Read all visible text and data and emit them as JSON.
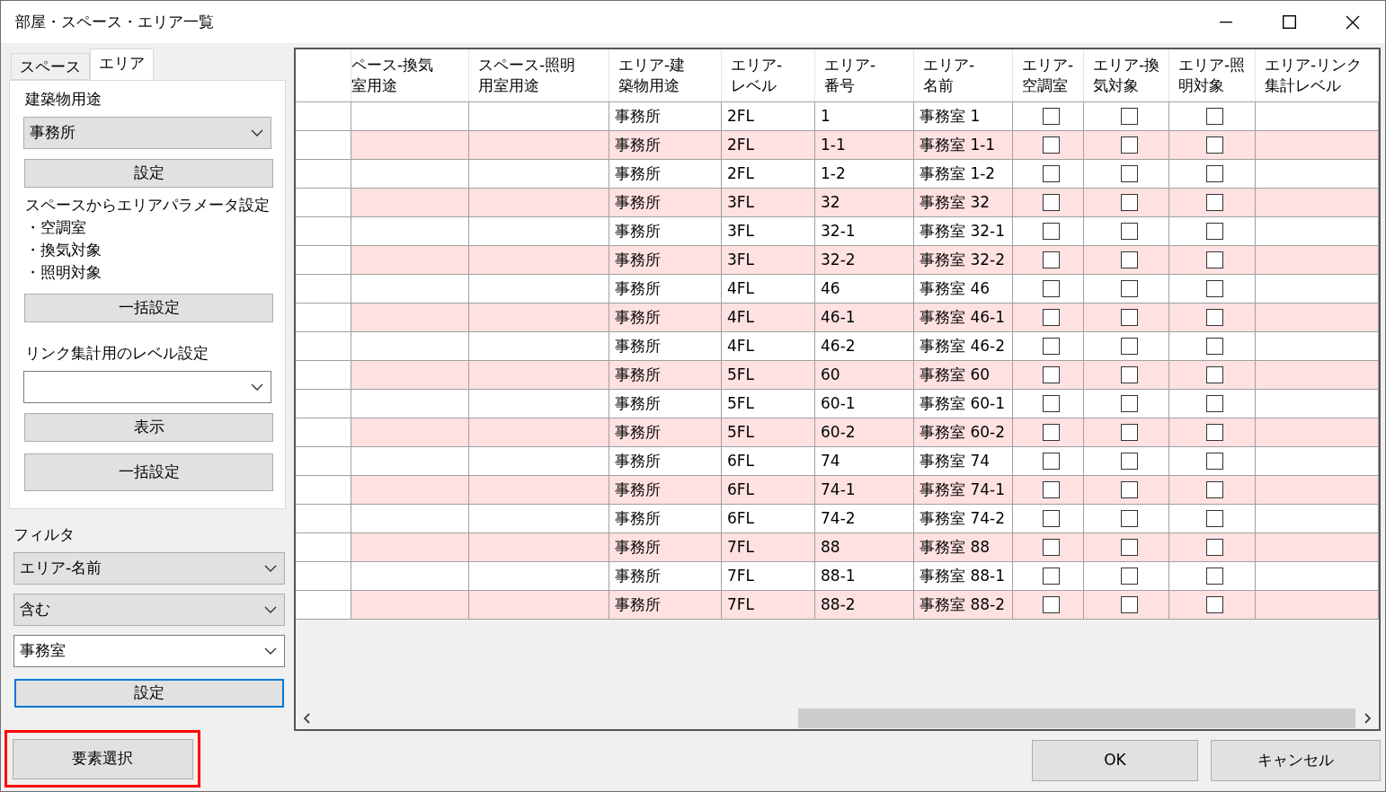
{
  "window": {
    "title": "部屋・スペース・エリア一覧"
  },
  "tabs": [
    {
      "label": "スペース",
      "selected": false
    },
    {
      "label": "エリア",
      "selected": true
    }
  ],
  "area_panel": {
    "building_use_label": "建築物用途",
    "building_use_select": "事務所",
    "set_button": "設定",
    "param_lines": [
      "スペースからエリアパラメータ設定",
      "・空調室",
      "・換気対象",
      "・照明対象"
    ],
    "bulk_button": "一括設定",
    "link_level_label": "リンク集計用のレベル設定",
    "show_button": "表示",
    "bulk_button_2": "一括設定"
  },
  "filter": {
    "label": "フィルタ",
    "field_select": "エリア-名前",
    "condition_select": "含む",
    "value_combo": "事務室",
    "set_button": "設定"
  },
  "table": {
    "columns": [
      {
        "lines": [
          "ペース-換気",
          "室用途"
        ]
      },
      {
        "lines": [
          "スペース-照明",
          "用室用途"
        ]
      },
      {
        "lines": [
          "エリア-建",
          "築物用途"
        ]
      },
      {
        "lines": [
          "エリア-",
          "レベル"
        ]
      },
      {
        "lines": [
          "エリア-",
          "番号"
        ]
      },
      {
        "lines": [
          "エリア-",
          "名前"
        ]
      },
      {
        "lines": [
          "エリア-",
          "空調室"
        ]
      },
      {
        "lines": [
          "エリア-換",
          "気対象"
        ]
      },
      {
        "lines": [
          "エリア-照",
          "明対象"
        ]
      },
      {
        "lines": [
          "エリア-リンク",
          "集計レベル"
        ]
      }
    ],
    "rows": [
      {
        "building_use": "事務所",
        "level": "2FL",
        "number": "1",
        "name": "事務室 1",
        "air_conditioned": false,
        "ventilated": false,
        "lit": false
      },
      {
        "building_use": "事務所",
        "level": "2FL",
        "number": "1-1",
        "name": "事務室 1-1",
        "air_conditioned": false,
        "ventilated": false,
        "lit": false
      },
      {
        "building_use": "事務所",
        "level": "2FL",
        "number": "1-2",
        "name": "事務室 1-2",
        "air_conditioned": false,
        "ventilated": false,
        "lit": false
      },
      {
        "building_use": "事務所",
        "level": "3FL",
        "number": "32",
        "name": "事務室 32",
        "air_conditioned": false,
        "ventilated": false,
        "lit": false
      },
      {
        "building_use": "事務所",
        "level": "3FL",
        "number": "32-1",
        "name": "事務室 32-1",
        "air_conditioned": false,
        "ventilated": false,
        "lit": false
      },
      {
        "building_use": "事務所",
        "level": "3FL",
        "number": "32-2",
        "name": "事務室 32-2",
        "air_conditioned": false,
        "ventilated": false,
        "lit": false
      },
      {
        "building_use": "事務所",
        "level": "4FL",
        "number": "46",
        "name": "事務室 46",
        "air_conditioned": false,
        "ventilated": false,
        "lit": false
      },
      {
        "building_use": "事務所",
        "level": "4FL",
        "number": "46-1",
        "name": "事務室 46-1",
        "air_conditioned": false,
        "ventilated": false,
        "lit": false
      },
      {
        "building_use": "事務所",
        "level": "4FL",
        "number": "46-2",
        "name": "事務室 46-2",
        "air_conditioned": false,
        "ventilated": false,
        "lit": false
      },
      {
        "building_use": "事務所",
        "level": "5FL",
        "number": "60",
        "name": "事務室 60",
        "air_conditioned": false,
        "ventilated": false,
        "lit": false
      },
      {
        "building_use": "事務所",
        "level": "5FL",
        "number": "60-1",
        "name": "事務室 60-1",
        "air_conditioned": false,
        "ventilated": false,
        "lit": false
      },
      {
        "building_use": "事務所",
        "level": "5FL",
        "number": "60-2",
        "name": "事務室 60-2",
        "air_conditioned": false,
        "ventilated": false,
        "lit": false
      },
      {
        "building_use": "事務所",
        "level": "6FL",
        "number": "74",
        "name": "事務室 74",
        "air_conditioned": false,
        "ventilated": false,
        "lit": false
      },
      {
        "building_use": "事務所",
        "level": "6FL",
        "number": "74-1",
        "name": "事務室 74-1",
        "air_conditioned": false,
        "ventilated": false,
        "lit": false
      },
      {
        "building_use": "事務所",
        "level": "6FL",
        "number": "74-2",
        "name": "事務室 74-2",
        "air_conditioned": false,
        "ventilated": false,
        "lit": false
      },
      {
        "building_use": "事務所",
        "level": "7FL",
        "number": "88",
        "name": "事務室 88",
        "air_conditioned": false,
        "ventilated": false,
        "lit": false
      },
      {
        "building_use": "事務所",
        "level": "7FL",
        "number": "88-1",
        "name": "事務室 88-1",
        "air_conditioned": false,
        "ventilated": false,
        "lit": false
      },
      {
        "building_use": "事務所",
        "level": "7FL",
        "number": "88-2",
        "name": "事務室 88-2",
        "air_conditioned": false,
        "ventilated": false,
        "lit": false
      }
    ]
  },
  "select_elements_button": {
    "label": "要素選択",
    "highlighted": true
  },
  "buttons": [
    "OK",
    "キャンセル"
  ]
}
